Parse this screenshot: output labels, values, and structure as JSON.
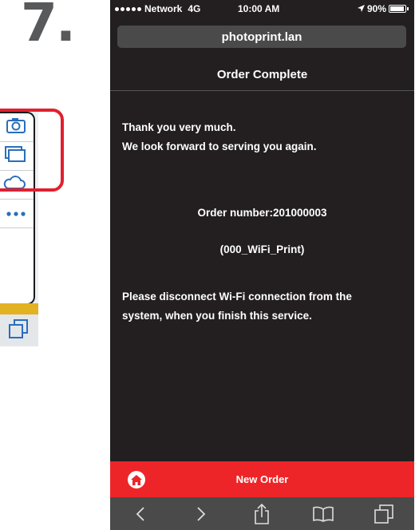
{
  "step": {
    "number": "7."
  },
  "status_bar": {
    "carrier": "Network",
    "network_type": "4G",
    "time": "10:00 AM",
    "battery": "90%"
  },
  "browser": {
    "url": "photoprint.lan"
  },
  "page": {
    "title": "Order Complete",
    "thanks_line1": "Thank you very much.",
    "thanks_line2": "We look forward to serving you again.",
    "order_number": "Order number:201000003",
    "order_id": "(000_WiFi_Print)",
    "disconnect_line1": "Please disconnect Wi-Fi connection from the",
    "disconnect_line2": "system, when you finish this service.",
    "new_order_label": "New Order"
  },
  "icons": {
    "left_panel": [
      "camera-icon",
      "tabs-icon",
      "cloud-icon",
      "more-icon",
      "tabs-icon"
    ],
    "toolbar": [
      "back-icon",
      "forward-icon",
      "share-icon",
      "bookmarks-icon",
      "tabs-icon"
    ]
  },
  "colors": {
    "accent_red": "#ee2528",
    "highlight_red": "#e1202e",
    "icon_blue": "#2a6ebb",
    "yellow": "#e2b223",
    "screen_bg": "#231f20"
  }
}
